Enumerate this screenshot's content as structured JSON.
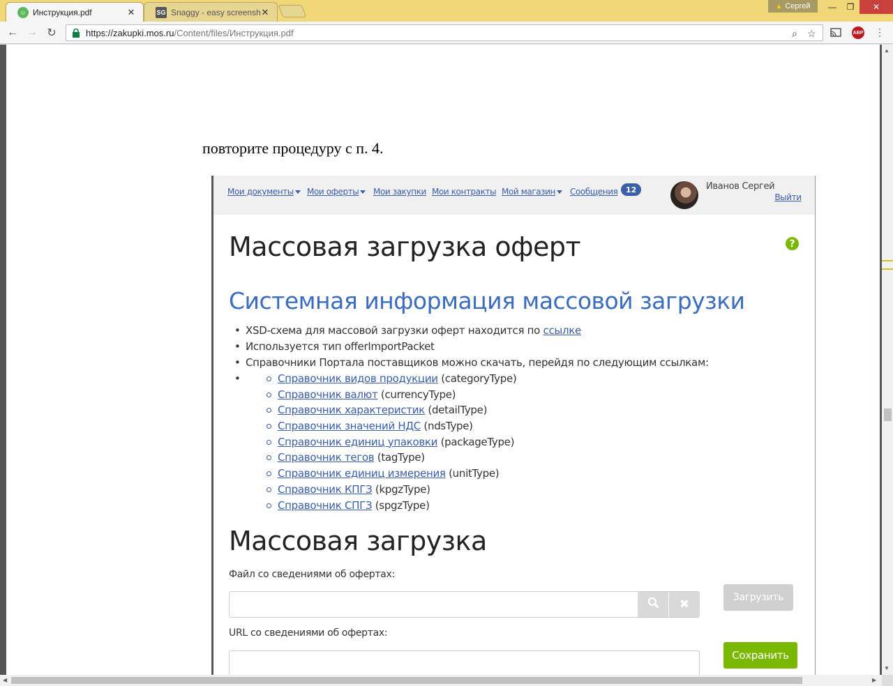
{
  "browser": {
    "tabs": [
      {
        "label": "Инструкция.pdf",
        "close": "✕"
      },
      {
        "label": "Snaggy - easy screensho",
        "close": "✕",
        "favicon": "SG"
      }
    ],
    "profile": "Сергей",
    "url_host": "https://zakupki.mos.ru",
    "url_path": "/Content/files/Инструкция.pdf",
    "ext_abp": "ABP"
  },
  "document": {
    "text": "повторите процедуру с п. 4."
  },
  "portal": {
    "nav": [
      {
        "label": "Мои документы",
        "caret": true
      },
      {
        "label": "Мои оферты",
        "caret": true
      },
      {
        "label": "Мои закупки",
        "caret": false
      },
      {
        "label": "Мои контракты",
        "caret": false
      },
      {
        "label": "Мой магазин",
        "caret": true
      },
      {
        "label": "Сообщения",
        "caret": false
      }
    ],
    "messages_count": "12",
    "user_name": "Иванов Сергей",
    "logout": "Выйти",
    "title": "Массовая загрузка оферт",
    "help": "?",
    "section_title": "Системная информация массовой загрузки",
    "bullets": {
      "xsd_text": "XSD-схема для массовой загрузки оферт находится по ",
      "xsd_link": "ссылке",
      "type_text": "Используется тип offerImportPacket",
      "refs_text": "Справочники Портала поставщиков можно скачать, перейдя по следующим ссылкам:"
    },
    "references": [
      {
        "link": "Справочник видов продукции",
        "type": " (categoryType)"
      },
      {
        "link": "Справочник валют",
        "type": " (currencyType)"
      },
      {
        "link": "Справочник характеристик",
        "type": " (detailType)"
      },
      {
        "link": "Справочник значений НДС",
        "type": " (ndsType)"
      },
      {
        "link": "Справочник единиц упаковки",
        "type": " (packageType)"
      },
      {
        "link": "Справочник тегов",
        "type": " (tagType)"
      },
      {
        "link": "Справочник единиц измерения",
        "type": " (unitType)"
      },
      {
        "link": "Справочник КПГЗ",
        "type": " (kpgzType)"
      },
      {
        "link": "Справочник СПГЗ",
        "type": " (spgzType)"
      }
    ],
    "upload_title": "Массовая загрузка",
    "file_label": "Файл со сведениями об офертах:",
    "upload_button": "Загрузить",
    "url_label": "URL со сведениями об офертах:",
    "save_button": "Сохранить"
  }
}
